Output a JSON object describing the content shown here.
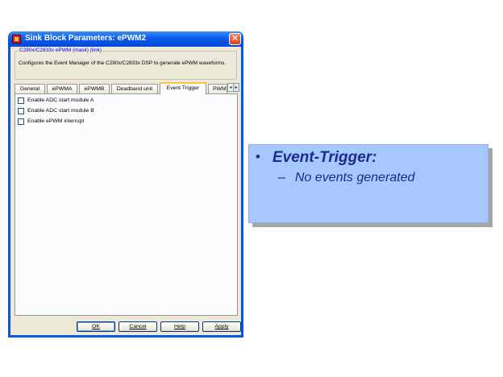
{
  "dialog": {
    "title": "Sink Block Parameters: ePWM2",
    "close_glyph": "✕",
    "block_type_link": "C280x/C2833x ePWM (mask) (link)",
    "description": "Configures the Event Manager of the C280x/C2833x DSP to generate ePWM waveforms."
  },
  "tabs": [
    {
      "label": "General"
    },
    {
      "label": "ePWMA"
    },
    {
      "label": "ePWMB"
    },
    {
      "label": "Deadband unit"
    },
    {
      "label": "Event Trigger",
      "active": true
    },
    {
      "label": "PWM"
    }
  ],
  "tab_scroll": {
    "left_glyph": "◂",
    "right_glyph": "▸"
  },
  "event_trigger": {
    "options": [
      {
        "label": "Enable ADC start module A",
        "checked": false
      },
      {
        "label": "Enable ADC start module B",
        "checked": false
      },
      {
        "label": "Enable ePWM interrupt",
        "checked": false
      }
    ]
  },
  "buttons": {
    "ok": "OK",
    "cancel": "Cancel",
    "help": "Help",
    "apply": "Apply"
  },
  "callout": {
    "bullet": "•",
    "heading": "Event-Trigger:",
    "dash": "–",
    "subtext": "No events generated"
  },
  "colors": {
    "titlebar": "#0a5ce8",
    "dialog_face": "#ece9d8",
    "callout_fill": "#a6c8ff",
    "callout_text": "#1e2a8a"
  },
  "icons": [
    "app-icon",
    "close-icon",
    "tab-scroll-left-icon",
    "tab-scroll-right-icon"
  ]
}
